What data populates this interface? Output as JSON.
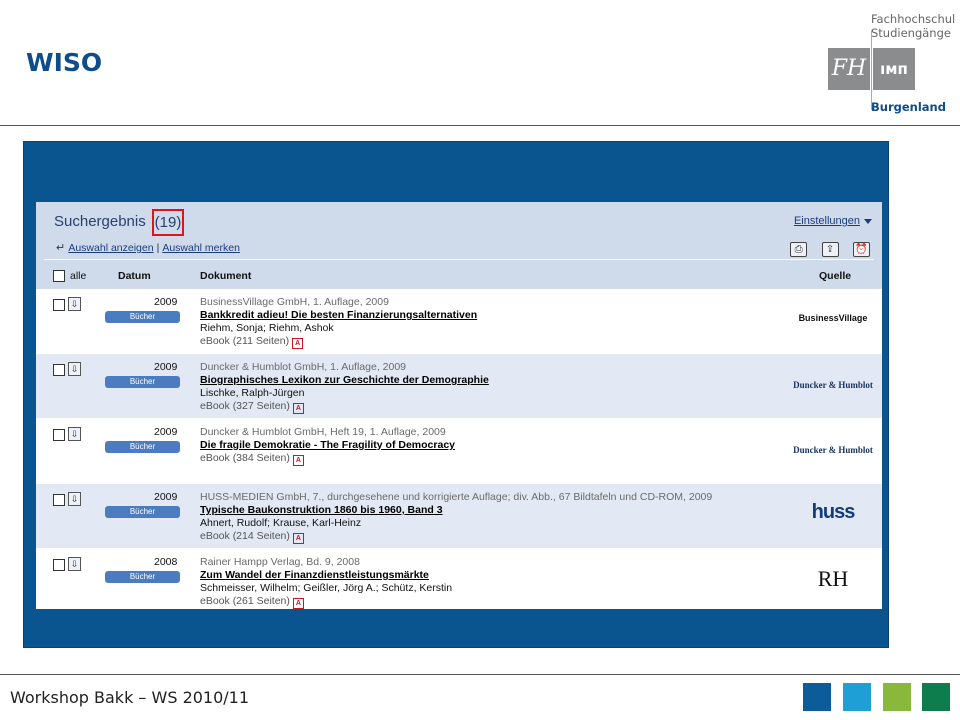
{
  "slide": {
    "title": "WISO",
    "footer": "Workshop Bakk – WS 2010/11",
    "logo": {
      "line1": "Fachhochschul",
      "line2": "Studiengänge",
      "box1": "FH",
      "box2": "ıмп",
      "bottom": "Burgenland"
    },
    "footer_squares": [
      "#0b5c98",
      "#1ea0d6",
      "#8ab83a",
      "#0e7d4e"
    ]
  },
  "results": {
    "title": "Suchergebnis",
    "count": "(19)",
    "settings_label": "Einstellungen",
    "show_selection": "Auswahl anzeigen",
    "separator": "|",
    "remember_selection": "Auswahl merken",
    "tool_icons": [
      "print-icon",
      "export-icon",
      "alarm-icon"
    ],
    "columns": {
      "all": "alle",
      "date": "Datum",
      "document": "Dokument",
      "source": "Quelle"
    },
    "rows": [
      {
        "year": "2009",
        "type": "Bücher",
        "publisher": "BusinessVillage GmbH, 1. Auflage, 2009",
        "title": "Bankkredit adieu! Die besten Finanzierungsalternativen",
        "authors": "Riehm, Sonja; Riehm, Ashok",
        "ebook": "eBook (211 Seiten)",
        "source": "BusinessVillage"
      },
      {
        "year": "2009",
        "type": "Bücher",
        "publisher": "Duncker & Humblot GmbH, 1. Auflage, 2009",
        "title": "Biographisches Lexikon zur Geschichte der Demographie",
        "authors": "Lischke, Ralph-Jürgen",
        "ebook": "eBook (327 Seiten)",
        "source": "Duncker & Humblot"
      },
      {
        "year": "2009",
        "type": "Bücher",
        "publisher": "Duncker & Humblot GmbH, Heft 19, 1. Auflage, 2009",
        "title": "Die fragile Demokratie - The Fragility of Democracy",
        "authors": "",
        "ebook": "eBook (384 Seiten)",
        "source": "Duncker & Humblot"
      },
      {
        "year": "2009",
        "type": "Bücher",
        "publisher": "HUSS-MEDIEN GmbH, 7., durchgesehene und korrigierte Auflage; div. Abb., 67 Bildtafeln und CD-ROM, 2009",
        "title": "Typische Baukonstruktion 1860 bis 1960, Band 3",
        "authors": "Ahnert, Rudolf; Krause, Karl-Heinz",
        "ebook": "eBook (214 Seiten)",
        "source": "huss"
      },
      {
        "year": "2008",
        "type": "Bücher",
        "publisher": "Rainer Hampp Verlag, Bd. 9, 2008",
        "title": "Zum Wandel der Finanzdienstleistungsmärkte",
        "authors": "Schmeisser, Wilhelm; Geißler, Jörg A.; Schütz, Kerstin",
        "ebook": "eBook (261 Seiten)",
        "source": "RH"
      }
    ]
  }
}
